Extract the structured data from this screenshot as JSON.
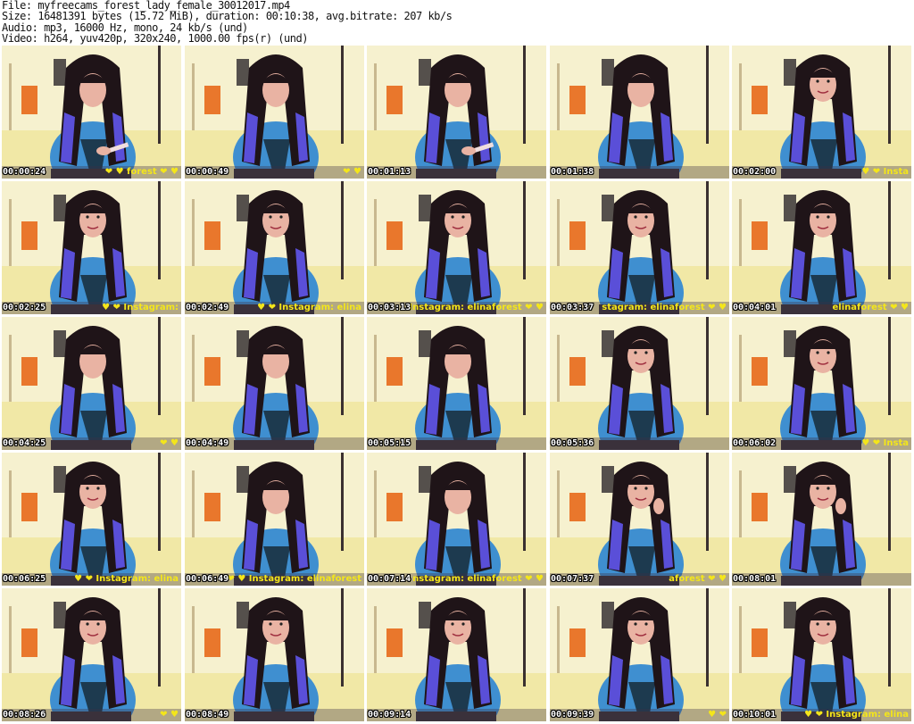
{
  "meta": {
    "file_line": "File: myfreecams_forest_lady_female_30012017.mp4",
    "size_line": "Size: 16481391 bytes (15.72 MiB), duration: 00:10:38, avg.bitrate: 207 kb/s",
    "audio_line": "Audio: mp3, 16000 Hz, mono, 24 kb/s (und)",
    "video_line": "Video: h264, yuv420p, 320x240, 1000.00 fps(r) (und)"
  },
  "colors": {
    "overlay_text": "#f4e61a",
    "shirt": "#3f8fd0",
    "hair": "#1f1418",
    "hair_highlight": "#5a4fd8",
    "wall": "#f6f1cf",
    "door": "#e9772c",
    "skin": "#e9b3a3"
  },
  "thumbnails": [
    {
      "time": "00:00:24",
      "overlay": "❤ ♥ forest ❤ ♥",
      "pose": "phone"
    },
    {
      "time": "00:00:49",
      "overlay": "❤ ♥",
      "pose": "down"
    },
    {
      "time": "00:01:13",
      "overlay": "",
      "pose": "phone"
    },
    {
      "time": "00:01:38",
      "overlay": "",
      "pose": "down"
    },
    {
      "time": "00:02:00",
      "overlay": "♥ ❤ Insta",
      "pose": "smile"
    },
    {
      "time": "00:02:25",
      "overlay": "♥ ❤ Instagram:",
      "pose": "smile"
    },
    {
      "time": "00:02:49",
      "overlay": "♥ ❤ Instagram: elina",
      "pose": "smile"
    },
    {
      "time": "00:03:13",
      "overlay": "Instagram: elinaforest ❤ ♥",
      "pose": "smile"
    },
    {
      "time": "00:03:37",
      "overlay": "stagram: elinaforest ❤ ♥",
      "pose": "smile"
    },
    {
      "time": "00:04:01",
      "overlay": "elinaforest ❤ ♥",
      "pose": "smile"
    },
    {
      "time": "00:04:25",
      "overlay": "❤ ♥",
      "pose": "down"
    },
    {
      "time": "00:04:49",
      "overlay": "",
      "pose": "down"
    },
    {
      "time": "00:05:15",
      "overlay": "",
      "pose": "down"
    },
    {
      "time": "00:05:36",
      "overlay": "",
      "pose": "smile"
    },
    {
      "time": "00:06:02",
      "overlay": "♥ ❤ Insta",
      "pose": "smile"
    },
    {
      "time": "00:06:25",
      "overlay": "♥ ❤ Instagram: elina",
      "pose": "smile"
    },
    {
      "time": "00:06:49",
      "overlay": "❤ ♥ Instagram: elinaforest",
      "pose": "down"
    },
    {
      "time": "00:07:14",
      "overlay": "nstagram: elinaforest ❤ ♥",
      "pose": "down"
    },
    {
      "time": "00:07:37",
      "overlay": "aforest ❤ ♥",
      "pose": "hand"
    },
    {
      "time": "00:08:01",
      "overlay": "",
      "pose": "hand"
    },
    {
      "time": "00:08:26",
      "overlay": "❤ ♥",
      "pose": "smile"
    },
    {
      "time": "00:08:49",
      "overlay": "",
      "pose": "smile"
    },
    {
      "time": "00:09:14",
      "overlay": "",
      "pose": "smile"
    },
    {
      "time": "00:09:39",
      "overlay": "♥ ❤",
      "pose": "smile"
    },
    {
      "time": "00:10:01",
      "overlay": "♥ ❤ Instagram: elina",
      "pose": "smile"
    }
  ]
}
